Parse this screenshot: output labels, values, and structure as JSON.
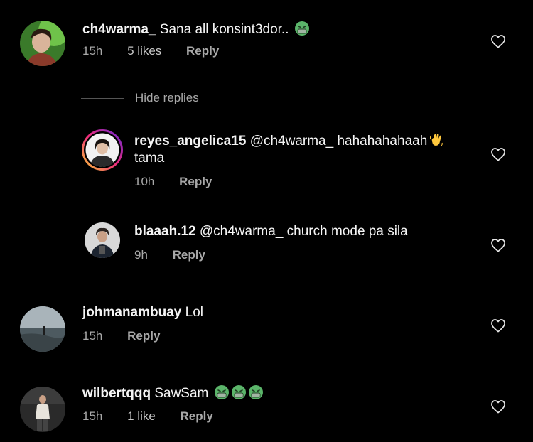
{
  "comments": [
    {
      "username": "ch4warma_",
      "text": "Sana all konsint3dor..",
      "emoji": [
        "nauseated-face"
      ],
      "time": "15h",
      "likes": "5 likes",
      "reply": "Reply"
    },
    {
      "username": "reyes_angelica15",
      "mention": "@ch4warma_",
      "text": "hahahahahaah",
      "emoji": [
        "waving-hand"
      ],
      "text2": "tama",
      "time": "10h",
      "reply": "Reply"
    },
    {
      "username": "blaaah.12",
      "mention": "@ch4warma_",
      "text": "church mode pa sila",
      "time": "9h",
      "reply": "Reply"
    },
    {
      "username": "johmanambuay",
      "text": "Lol",
      "time": "15h",
      "reply": "Reply"
    },
    {
      "username": "wilbertqqq",
      "text": "SawSam",
      "emoji": [
        "nauseated-face",
        "nauseated-face",
        "nauseated-face"
      ],
      "time": "15h",
      "likes": "1 like",
      "reply": "Reply"
    }
  ],
  "hide_replies_label": "Hide replies",
  "icons": {
    "like": "heart-outline-icon",
    "story_ring_gradient": [
      "#f9ce34",
      "#ee2a7b",
      "#6228d7"
    ]
  }
}
